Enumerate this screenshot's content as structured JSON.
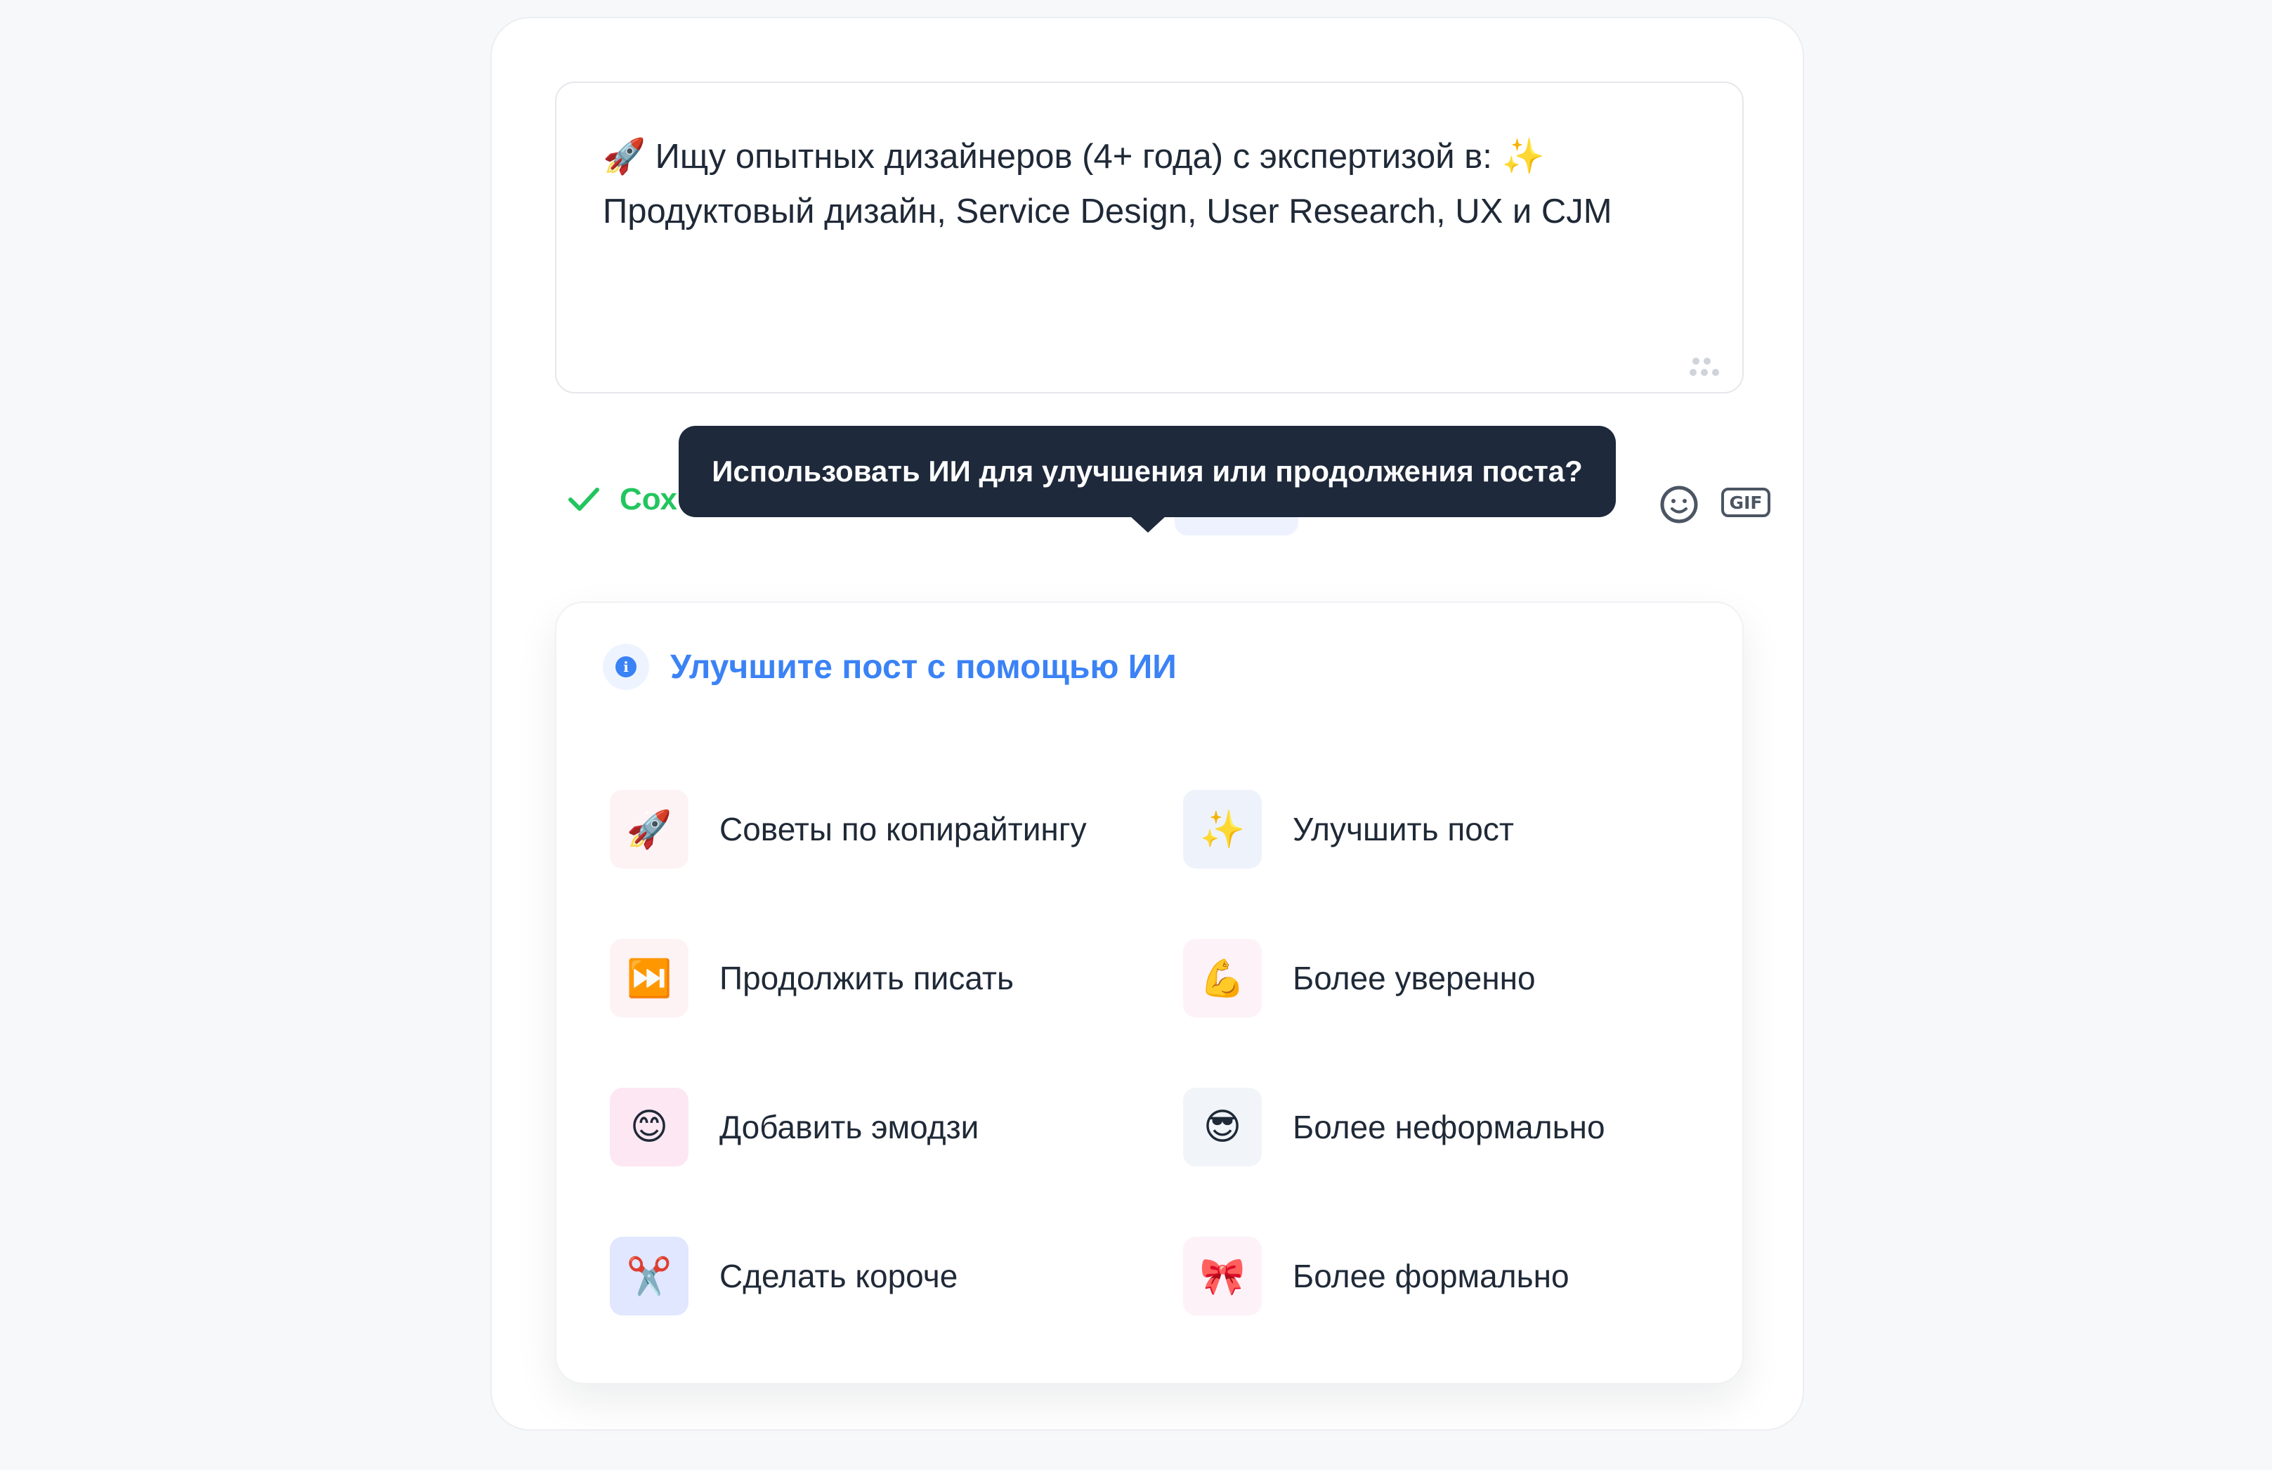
{
  "editor": {
    "text": "🚀 Ищу опытных дизайнеров (4+ года) с экспертизой в: ✨ Продуктовый дизайн, Service Design, User Research, UX и CJM"
  },
  "toolbar": {
    "saved_label": "Сох",
    "gif_label": "GIF",
    "saved_color": "#22c55e"
  },
  "tooltip": {
    "text": "Использовать ИИ для улучшения или продолжения поста?"
  },
  "ai_panel": {
    "title": "Улучшите пост с помощью ИИ",
    "accent_color": "#3b82f6",
    "options": [
      {
        "label": "Советы по копирайтингу",
        "emoji": "🚀",
        "bg": "#fdf2f4"
      },
      {
        "label": "Улучшить пост",
        "emoji": "✨",
        "bg": "#eef2fb"
      },
      {
        "label": "Продолжить писать",
        "emoji": "⏭️",
        "bg": "#fdf2f4"
      },
      {
        "label": "Более уверенно",
        "emoji": "💪",
        "bg": "#fdf2f8"
      },
      {
        "label": "Добавить эмодзи",
        "emoji": "😊",
        "bg": "#fce7f3"
      },
      {
        "label": "Более неформально",
        "emoji": "😎",
        "bg": "#f1f5f9"
      },
      {
        "label": "Сделать короче",
        "emoji": "✂️",
        "bg": "#e0e7ff"
      },
      {
        "label": "Более формально",
        "emoji": "🎀",
        "bg": "#fdf2f8"
      }
    ]
  }
}
